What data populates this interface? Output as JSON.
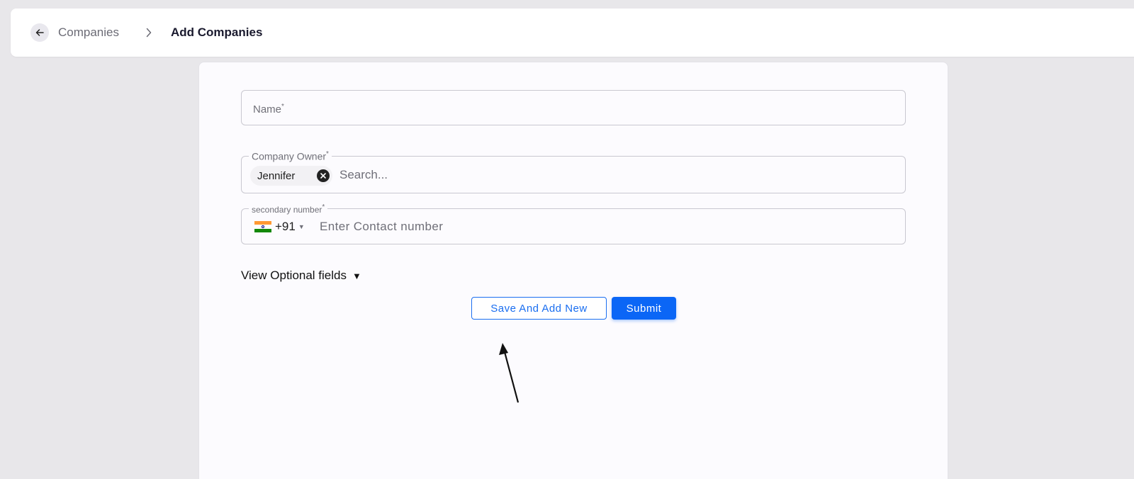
{
  "header": {
    "back_icon": "arrow-left-icon",
    "breadcrumb_parent": "Companies",
    "separator_icon": "chevron-right-icon",
    "breadcrumb_current": "Add Companies"
  },
  "form": {
    "name_field": {
      "placeholder": "Name",
      "required_mark": "*"
    },
    "company_owner": {
      "label": "Company Owner",
      "required_mark": "*",
      "selected_chip": "Jennifer",
      "chip_remove_icon": "close-circle-icon",
      "search_placeholder": "Search..."
    },
    "secondary_number": {
      "label": "secondary number",
      "required_mark": "*",
      "country_flag": "india-flag-icon",
      "dial_code": "+91",
      "dropdown_icon": "caret-down-icon",
      "placeholder": "Enter Contact number"
    },
    "optional_fields": {
      "label": "View Optional fields",
      "toggle_icon": "triangle-down-icon"
    }
  },
  "actions": {
    "save_and_add_new": "Save And Add New",
    "submit": "Submit"
  },
  "colors": {
    "accent": "#0b66f6",
    "background": "#e8e7ea",
    "card": "#fcfbfe"
  }
}
